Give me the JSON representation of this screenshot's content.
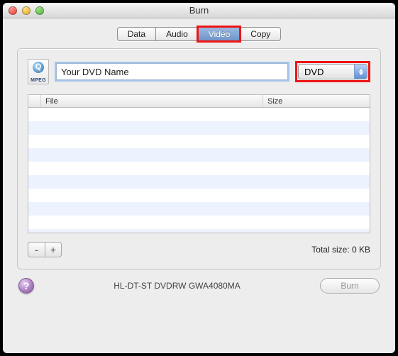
{
  "window": {
    "title": "Burn"
  },
  "tabs": [
    {
      "label": "Data",
      "selected": false
    },
    {
      "label": "Audio",
      "selected": false
    },
    {
      "label": "Video",
      "selected": true,
      "highlight": true
    },
    {
      "label": "Copy",
      "selected": false
    }
  ],
  "icon": {
    "caption": "MPEG"
  },
  "disc_name": {
    "value": "Your DVD Name"
  },
  "format": {
    "selected": "DVD",
    "highlight": true
  },
  "table": {
    "columns": {
      "file": "File",
      "size": "Size"
    },
    "rows": []
  },
  "buttons": {
    "remove": "-",
    "add": "+",
    "burn": "Burn",
    "help": "?"
  },
  "total_size": {
    "label": "Total size:",
    "value": "0 KB"
  },
  "device": "HL-DT-ST DVDRW GWA4080MA"
}
